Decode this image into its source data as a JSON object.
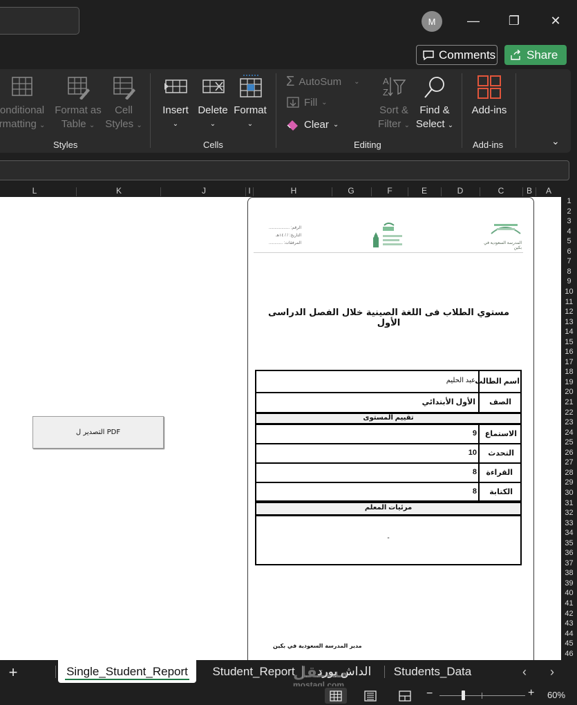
{
  "titlebar": {
    "avatar_initial": "M",
    "minimize_glyph": "—",
    "restore_glyph": "❐",
    "close_glyph": "✕"
  },
  "actions": {
    "comments_label": "Comments",
    "share_label": "Share"
  },
  "ribbon": {
    "styles": {
      "group_label": "Styles",
      "conditional_line1": "onditional",
      "conditional_line2": "rmatting",
      "format_table_line1": "Format as",
      "format_table_line2": "Table",
      "cell_styles_line1": "Cell",
      "cell_styles_line2": "Styles"
    },
    "cells": {
      "group_label": "Cells",
      "insert_label": "Insert",
      "delete_label": "Delete",
      "format_label": "Format"
    },
    "editing": {
      "group_label": "Editing",
      "autosum_label": "AutoSum",
      "fill_label": "Fill",
      "clear_label": "Clear",
      "sort_line1": "Sort &",
      "sort_line2": "Filter",
      "find_line1": "Find &",
      "find_line2": "Select"
    },
    "addins": {
      "group_label": "Add-ins",
      "addins_label": "Add-ins"
    }
  },
  "columns": [
    "L",
    "K",
    "J",
    "I",
    "H",
    "G",
    "F",
    "E",
    "D",
    "C",
    "B",
    "A"
  ],
  "rows": [
    "1",
    "2",
    "3",
    "4",
    "5",
    "6",
    "7",
    "8",
    "9",
    "10",
    "11",
    "12",
    "13",
    "14",
    "15",
    "16",
    "17",
    "18",
    "19",
    "20",
    "21",
    "22",
    "23",
    "24",
    "25",
    "26",
    "27",
    "28",
    "29",
    "30",
    "31",
    "32",
    "33",
    "34",
    "35",
    "36",
    "37",
    "38",
    "39",
    "40",
    "41",
    "42",
    "43",
    "44",
    "45",
    "46"
  ],
  "sheet": {
    "export_button_label": "التصدير ل PDF",
    "letterhead_left_lines": [
      "الرقم: ..................",
      "التاريخ:  /  /  ١٤هـ",
      "المرفقات: ............"
    ],
    "letterhead_right_text": "المدرسة السعودية في بكين",
    "report_title": "مستوي الطلاب فى اللغة الصينية خلال الفصل الدراسى الأول",
    "student_label": "اسم الطالب",
    "student_value": "عبد الحليم",
    "grade_label": "الصف",
    "grade_value": "الأول الأبتدائي",
    "level_section": "تقييم المستوى",
    "skills": [
      {
        "label": "الاستماع",
        "score": "9"
      },
      {
        "label": "التحدث",
        "score": "10"
      },
      {
        "label": "القراءة",
        "score": "8"
      },
      {
        "label": "الكتابة",
        "score": "8"
      }
    ],
    "teacher_section": "مرئيات المعلم",
    "teacher_notes": "-",
    "signature": "مدير المدرسة السعودية في بكين"
  },
  "tabs": {
    "add_glyph": "+",
    "items": [
      {
        "label": "Single_Student_Report",
        "active": true
      },
      {
        "label": "Student_Report",
        "active": false
      },
      {
        "label": "الداش بورد",
        "active": false
      },
      {
        "label": "Students_Data",
        "active": false
      }
    ],
    "prev_glyph": "‹",
    "next_glyph": "›"
  },
  "watermark": {
    "arabic": "مستقل",
    "latin": "mostaql.com"
  },
  "status": {
    "zoom_minus": "−",
    "zoom_plus": "+",
    "zoom_level": "60%",
    "zoom_fraction": 0.6
  }
}
